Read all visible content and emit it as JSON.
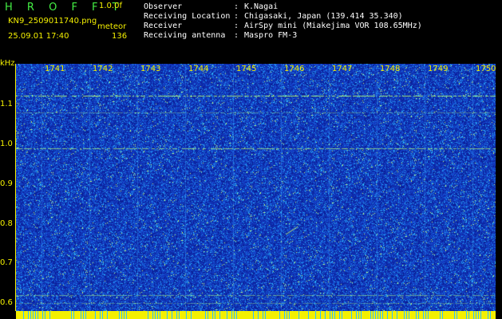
{
  "header": {
    "brand": "H R O F F T",
    "version": "1.0.0f",
    "filename": "KN9_2509011740.png",
    "mode": "meteor",
    "datetime": "25.09.01 17:40",
    "count": "136"
  },
  "info": [
    {
      "label": "Observer",
      "value": "K.Nagai"
    },
    {
      "label": "Receiving Location",
      "value": "Chigasaki, Japan (139.414 35.340)"
    },
    {
      "label": "Receiver",
      "value": "AirSpy mini (Miakejima VOR 108.65MHz)"
    },
    {
      "label": "Receiving antenna",
      "value": "Maspro FM-3"
    }
  ],
  "colon": ":",
  "spectrogram": {
    "unit": "kHz",
    "y_ticks": [
      "1.1",
      "1.0",
      "0.9",
      "0.8",
      "0.7",
      "0.6"
    ],
    "x_ticks": [
      "1741",
      "1742",
      "1743",
      "1744",
      "1745",
      "1746",
      "1747",
      "1748",
      "1749",
      "1750"
    ],
    "colors": {
      "background": "#1030b0",
      "noise": "#30c0ff",
      "hot": "#ffff40",
      "axis": "#f4f000"
    }
  }
}
